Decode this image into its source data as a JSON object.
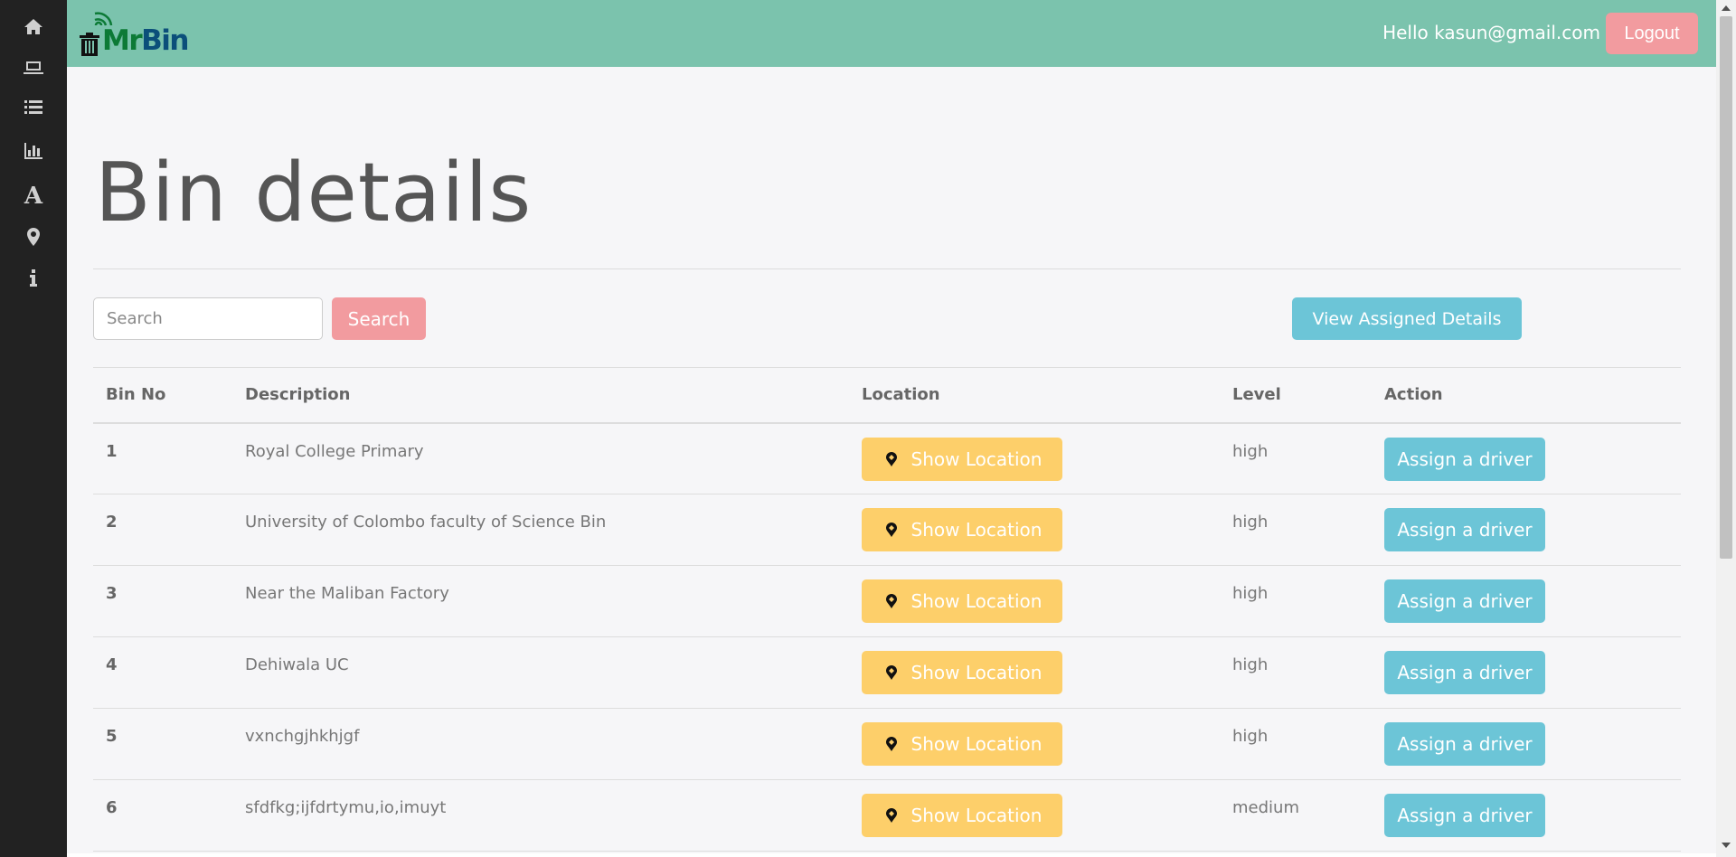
{
  "header": {
    "logo_mr": "Mr",
    "logo_bin": "Bin",
    "greeting": "Hello kasun@gmail.com",
    "logout_label": "Logout"
  },
  "sidebar": {
    "items": [
      {
        "icon": "home-icon"
      },
      {
        "icon": "laptop-icon"
      },
      {
        "icon": "list-icon"
      },
      {
        "icon": "bar-chart-icon"
      },
      {
        "icon": "font-icon",
        "text": "A"
      },
      {
        "icon": "map-marker-icon"
      },
      {
        "icon": "info-icon"
      }
    ]
  },
  "main": {
    "title": "Bin details",
    "search_placeholder": "Search",
    "search_label": "Search",
    "view_assigned_label": "View Assigned Details"
  },
  "table": {
    "headers": [
      "Bin No",
      "Description",
      "Location",
      "Level",
      "Action"
    ],
    "rows": [
      {
        "no": "1",
        "description": "Royal College Primary",
        "location_label": "Show Location",
        "level": "high",
        "action_label": "Assign a driver"
      },
      {
        "no": "2",
        "description": "University of Colombo faculty of Science Bin",
        "location_label": "Show Location",
        "level": "high",
        "action_label": "Assign a driver"
      },
      {
        "no": "3",
        "description": "Near the Maliban Factory",
        "location_label": "Show Location",
        "level": "high",
        "action_label": "Assign a driver"
      },
      {
        "no": "4",
        "description": "Dehiwala UC",
        "location_label": "Show Location",
        "level": "high",
        "action_label": "Assign a driver"
      },
      {
        "no": "5",
        "description": "vxnchgjhkhjgf",
        "location_label": "Show Location",
        "level": "high",
        "action_label": "Assign a driver"
      },
      {
        "no": "6",
        "description": "sfdfkg;ijfdrtymu,io,imuyt",
        "location_label": "Show Location",
        "level": "medium",
        "action_label": "Assign a driver"
      }
    ]
  },
  "colors": {
    "header_bg": "#7bc3ad",
    "sidebar_bg": "#222222",
    "logout_btn": "#f29b9f",
    "info_btn": "#6cc5d7",
    "warning_btn": "#fdcf6a"
  }
}
